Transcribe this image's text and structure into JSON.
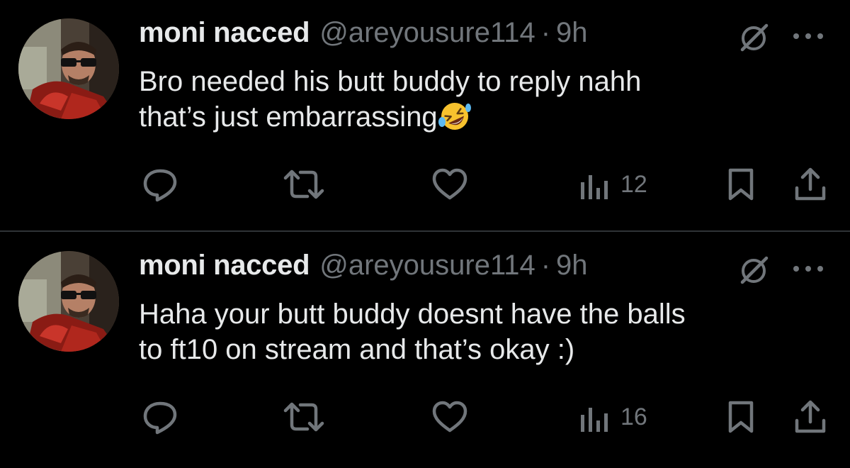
{
  "colors": {
    "background": "#000000",
    "primary_text": "#e7e9ea",
    "secondary_text": "#71767b",
    "divider": "#2f3336"
  },
  "tweets": [
    {
      "display_name": "moni nacced",
      "handle": "@areyousure114",
      "separator": "·",
      "time": "9h",
      "text": "Bro needed his butt buddy to reply nahh\nthat’s just embarrassing",
      "emoji": "rolling-on-floor-laughing",
      "views": "12",
      "icons": [
        "reply-icon",
        "retweet-icon",
        "like-icon",
        "views-icon",
        "bookmark-icon",
        "share-icon",
        "grok-icon",
        "more-icon"
      ]
    },
    {
      "display_name": "moni nacced",
      "handle": "@areyousure114",
      "separator": "·",
      "time": "9h",
      "text": "Haha your butt buddy doesnt have the balls\nto ft10 on stream and that’s okay :)",
      "views": "16",
      "icons": [
        "reply-icon",
        "retweet-icon",
        "like-icon",
        "views-icon",
        "bookmark-icon",
        "share-icon",
        "grok-icon",
        "more-icon"
      ]
    }
  ]
}
